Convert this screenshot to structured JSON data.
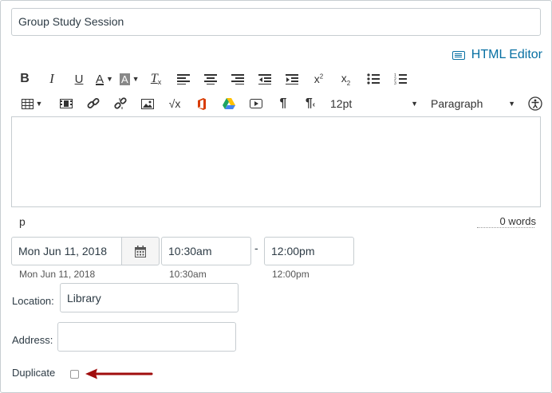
{
  "title_input": {
    "value": "Group Study Session"
  },
  "html_editor_link": {
    "label": "HTML Editor",
    "icon": "keyboard-icon"
  },
  "toolbar1": {
    "bold": "B",
    "italic": "I",
    "underline": "U",
    "font_color": "A",
    "bg_color": "A",
    "clear_format": "T",
    "superscript": "x",
    "superscript_mark": "2",
    "subscript": "x",
    "subscript_mark": "2"
  },
  "toolbar2": {
    "font_size": "12pt",
    "paragraph": "Paragraph",
    "sqrt_label": "√x"
  },
  "editor": {
    "status_path": "p",
    "word_count": "0 words"
  },
  "date": {
    "date_value": "Mon Jun 11, 2018",
    "date_hint": "Mon Jun 11, 2018",
    "start_value": "10:30am",
    "start_hint": "10:30am",
    "separator": "-",
    "end_value": "12:00pm",
    "end_hint": "12:00pm"
  },
  "location": {
    "label": "Location:",
    "value": "Library"
  },
  "address": {
    "label": "Address:",
    "value": ""
  },
  "duplicate": {
    "label": "Duplicate",
    "checked": false
  },
  "colors": {
    "link": "#0770a3",
    "arrow": "#a00d0d",
    "border": "#c7cdd1"
  }
}
